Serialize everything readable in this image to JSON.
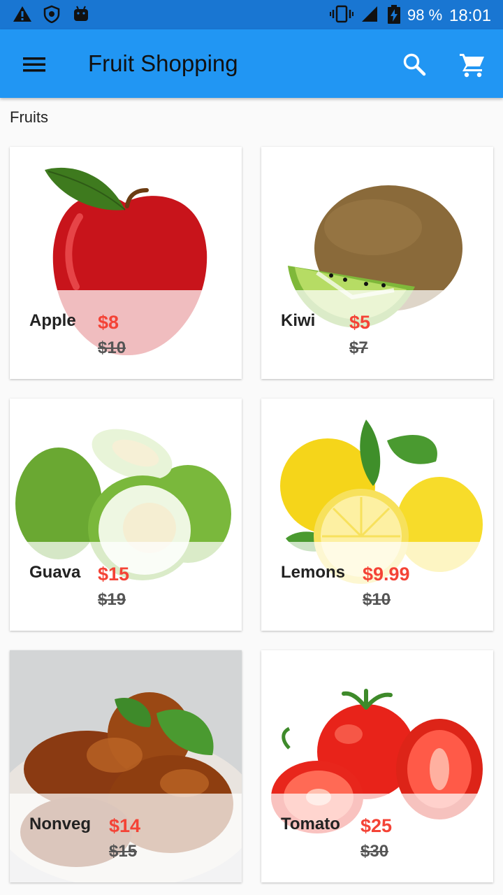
{
  "status_bar": {
    "battery": "98 %",
    "time": "18:01",
    "icons": [
      "warning-icon",
      "shield-icon",
      "android-icon",
      "vibrate-icon",
      "signal-icon",
      "battery-charging-icon"
    ]
  },
  "app_bar": {
    "title": "Fruit Shopping",
    "icons": [
      "menu-icon",
      "search-icon",
      "cart-icon"
    ]
  },
  "section": {
    "label": "Fruits"
  },
  "products": [
    {
      "name": "Apple",
      "price": "$8",
      "old_price": "$10"
    },
    {
      "name": "Kiwi",
      "price": "$5",
      "old_price": "$7"
    },
    {
      "name": "Guava",
      "price": "$15",
      "old_price": "$19"
    },
    {
      "name": "Lemons",
      "price": "$9.99",
      "old_price": "$10"
    },
    {
      "name": "Nonveg",
      "price": "$14",
      "old_price": "$15"
    },
    {
      "name": "Tomato",
      "price": "$25",
      "old_price": "$30"
    }
  ],
  "colors": {
    "status_bar": "#1976d2",
    "app_bar": "#2196f3",
    "price": "#f44336"
  }
}
